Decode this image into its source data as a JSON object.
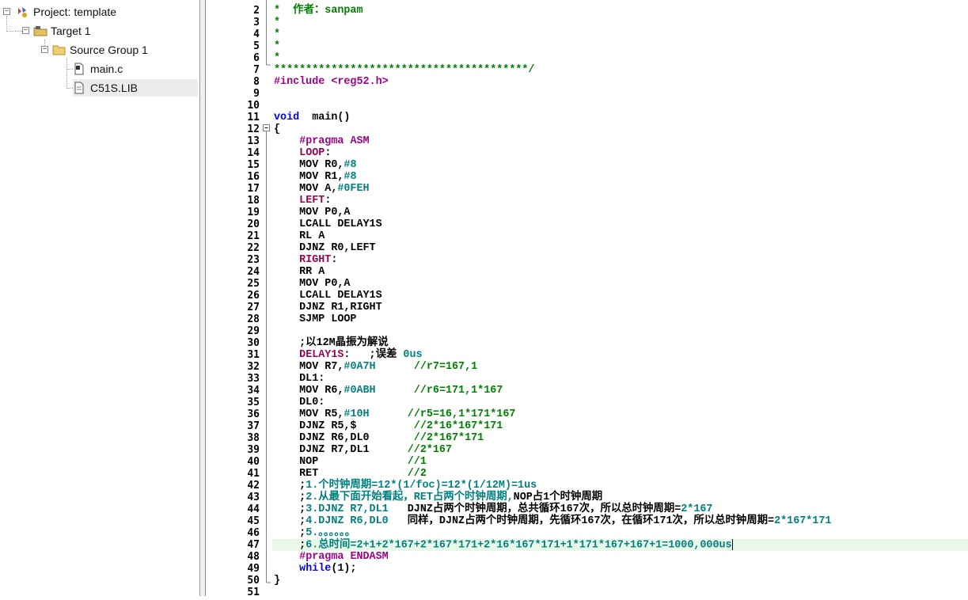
{
  "tree": {
    "project": "Project: template",
    "target": "Target 1",
    "group": "Source Group 1",
    "files": [
      "main.c",
      "C51S.LIB"
    ]
  },
  "editor": {
    "line_numbers": [
      "2",
      "3",
      "4",
      "5",
      "6",
      "7",
      "8",
      "9",
      "10",
      "11",
      "12",
      "13",
      "14",
      "15",
      "16",
      "17",
      "18",
      "19",
      "20",
      "21",
      "22",
      "23",
      "24",
      "25",
      "26",
      "27",
      "28",
      "29",
      "30",
      "31",
      "32",
      "33",
      "34",
      "35",
      "36",
      "37",
      "38",
      "39",
      "40",
      "41",
      "42",
      "43",
      "44",
      "45",
      "46",
      "47",
      "48",
      "49",
      "50",
      "51"
    ],
    "lines": [
      [
        [
          "cm",
          "*  作者：sanpam"
        ]
      ],
      [
        [
          "cm",
          "*"
        ]
      ],
      [
        [
          "cm",
          "*"
        ]
      ],
      [
        [
          "cm",
          "*"
        ]
      ],
      [
        [
          "cm",
          "*"
        ]
      ],
      [
        [
          "cm",
          "****************************************/"
        ]
      ],
      [
        [
          "pp",
          "#include <reg52.h>"
        ]
      ],
      [],
      [],
      [
        [
          "kw",
          "void"
        ],
        [
          "",
          "  main()"
        ]
      ],
      [
        [
          "",
          "{"
        ]
      ],
      [
        [
          "",
          "    "
        ],
        [
          "pp",
          "#pragma ASM"
        ]
      ],
      [
        [
          "",
          "    "
        ],
        [
          "lb",
          "LOOP"
        ],
        [
          "",
          ":"
        ]
      ],
      [
        [
          "",
          "    MOV R0,"
        ],
        [
          "nm",
          "#8"
        ]
      ],
      [
        [
          "",
          "    MOV R1,"
        ],
        [
          "nm",
          "#8"
        ]
      ],
      [
        [
          "",
          "    MOV A,"
        ],
        [
          "nm",
          "#0FEH"
        ]
      ],
      [
        [
          "",
          "    "
        ],
        [
          "lb",
          "LEFT"
        ],
        [
          "",
          ":"
        ]
      ],
      [
        [
          "",
          "    MOV P0,A"
        ]
      ],
      [
        [
          "",
          "    LCALL DELAY1S"
        ]
      ],
      [
        [
          "",
          "    RL A"
        ]
      ],
      [
        [
          "",
          "    DJNZ R0,LEFT"
        ]
      ],
      [
        [
          "",
          "    "
        ],
        [
          "lb",
          "RIGHT"
        ],
        [
          "",
          ":"
        ]
      ],
      [
        [
          "",
          "    RR A"
        ]
      ],
      [
        [
          "",
          "    MOV P0,A"
        ]
      ],
      [
        [
          "",
          "    LCALL DELAY1S"
        ]
      ],
      [
        [
          "",
          "    DJNZ R1,RIGHT"
        ]
      ],
      [
        [
          "",
          "    SJMP LOOP"
        ]
      ],
      [],
      [
        [
          "",
          "    ;以12M晶振为解说"
        ]
      ],
      [
        [
          "",
          "    "
        ],
        [
          "lb",
          "DELAY1S"
        ],
        [
          "",
          ":   ;误差 "
        ],
        [
          "nm",
          "0us"
        ]
      ],
      [
        [
          "",
          "    MOV R7,"
        ],
        [
          "nm",
          "#0A7H"
        ],
        [
          "",
          "      "
        ],
        [
          "cm",
          "//r7=167,1"
        ]
      ],
      [
        [
          "",
          "    DL1:"
        ]
      ],
      [
        [
          "",
          "    MOV R6,"
        ],
        [
          "nm",
          "#0ABH"
        ],
        [
          "",
          "      "
        ],
        [
          "cm",
          "//r6=171,1*167"
        ]
      ],
      [
        [
          "",
          "    DL0:"
        ]
      ],
      [
        [
          "",
          "    MOV R5,"
        ],
        [
          "nm",
          "#10H"
        ],
        [
          "",
          "      "
        ],
        [
          "cm",
          "//r5=16,1*171*167"
        ]
      ],
      [
        [
          "",
          "    DJNZ R5,$         "
        ],
        [
          "cm",
          "//2*16*167*171"
        ]
      ],
      [
        [
          "",
          "    DJNZ R6,DL0       "
        ],
        [
          "cm",
          "//2*167*171"
        ]
      ],
      [
        [
          "",
          "    DJNZ R7,DL1      "
        ],
        [
          "cm",
          "//2*167"
        ]
      ],
      [
        [
          "",
          "    NOP              "
        ],
        [
          "cm",
          "//1"
        ]
      ],
      [
        [
          "",
          "    RET              "
        ],
        [
          "cm",
          "//2"
        ]
      ],
      [
        [
          "",
          "    ;"
        ],
        [
          "nm",
          "1.个时钟周期=12*(1/foc)=12*(1/12M)=1us"
        ]
      ],
      [
        [
          "",
          "    ;"
        ],
        [
          "nm",
          "2.从最下面开始看起，RET占两个时钟周期,"
        ],
        [
          "",
          "NOP占1个时钟周期"
        ]
      ],
      [
        [
          "",
          "    ;"
        ],
        [
          "nm",
          "3.DJNZ R7,DL1"
        ],
        [
          "",
          "   DJNZ占两个时钟周期，总共循环167次，所以总时钟周期="
        ],
        [
          "nm",
          "2*167"
        ]
      ],
      [
        [
          "",
          "    ;"
        ],
        [
          "nm",
          "4.DJNZ R6,DL0"
        ],
        [
          "",
          "   同样，DJNZ占两个时钟周期，先循环167次，在循环171次，所以总时钟周期="
        ],
        [
          "nm",
          "2*167*171"
        ]
      ],
      [
        [
          "",
          "    ;"
        ],
        [
          "nm",
          "5.。。。。。。"
        ]
      ],
      [
        [
          "",
          "    ;"
        ],
        [
          "nm",
          "6.总时间=2+1+2*167+2*167*171+2*16*167*171+1*171*167+167+1=1000,000us"
        ]
      ],
      [
        [
          "",
          "    "
        ],
        [
          "pp",
          "#pragma ENDASM"
        ]
      ],
      [
        [
          "",
          "    "
        ],
        [
          "kw",
          "while"
        ],
        [
          "",
          "(1);"
        ]
      ],
      [
        [
          "",
          "}"
        ]
      ],
      []
    ]
  }
}
